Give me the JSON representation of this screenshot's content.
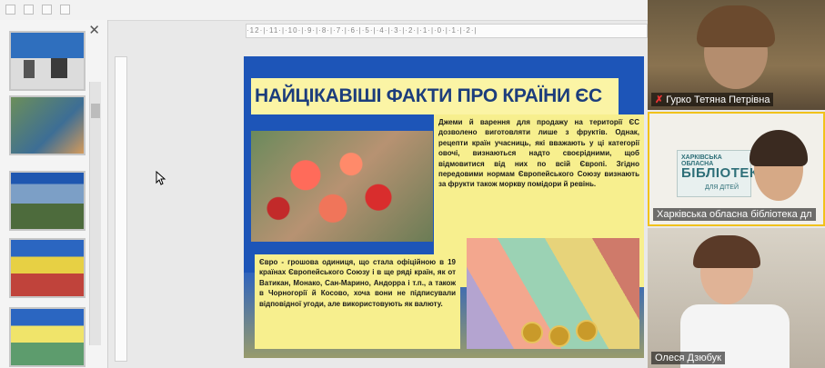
{
  "slide": {
    "title": "НАЙЦІКАВІШІ ФАКТИ ПРО КРАЇНИ ЄС",
    "text_top": "Джеми й варення для продажу на території ЄС дозволено виготовляти лише з фруктів. Однак, рецепти країн учасниць, які вважають у ці категорії овочі, визнаються надто своєрідними, щоб відмовитися від них по всій Європі. Згідно передовими нормам Європейського Союзу визнають за фрукти також моркву помідори й ревінь.",
    "text_bottom": "Євро - грошова одиниця, що стала офіційною в 19 країнах Європейського Союзу і в ще ряді країн, як от Ватикан, Монако, Сан-Марино, Андорра і т.п., а також в Чорногорії й Косово, хоча вони не підписували відповідної угоди, але використовують як валюту."
  },
  "ruler_text": "·12·|·11·|·10·|·9·|·8·|·7·|·6·|·5·|·4·|·3·|·2·|·1·|·0·|·1·|·2·|",
  "participants": [
    {
      "name": "Гурко Тетяна Петрівна",
      "muted": true
    },
    {
      "name": "Харківська обласна бібліотека дл"
    },
    {
      "name": "Олеся Дзюбук"
    }
  ],
  "banner": {
    "line1": "ХАРКІВСЬКА ОБЛАСНА",
    "line2": "БІБЛІОТЕКА",
    "line3": "ДЛЯ ДІТЕЙ"
  },
  "icons": {
    "close": "close-icon",
    "mute": "muted-mic-icon",
    "cursor": "mouse-cursor-icon"
  }
}
